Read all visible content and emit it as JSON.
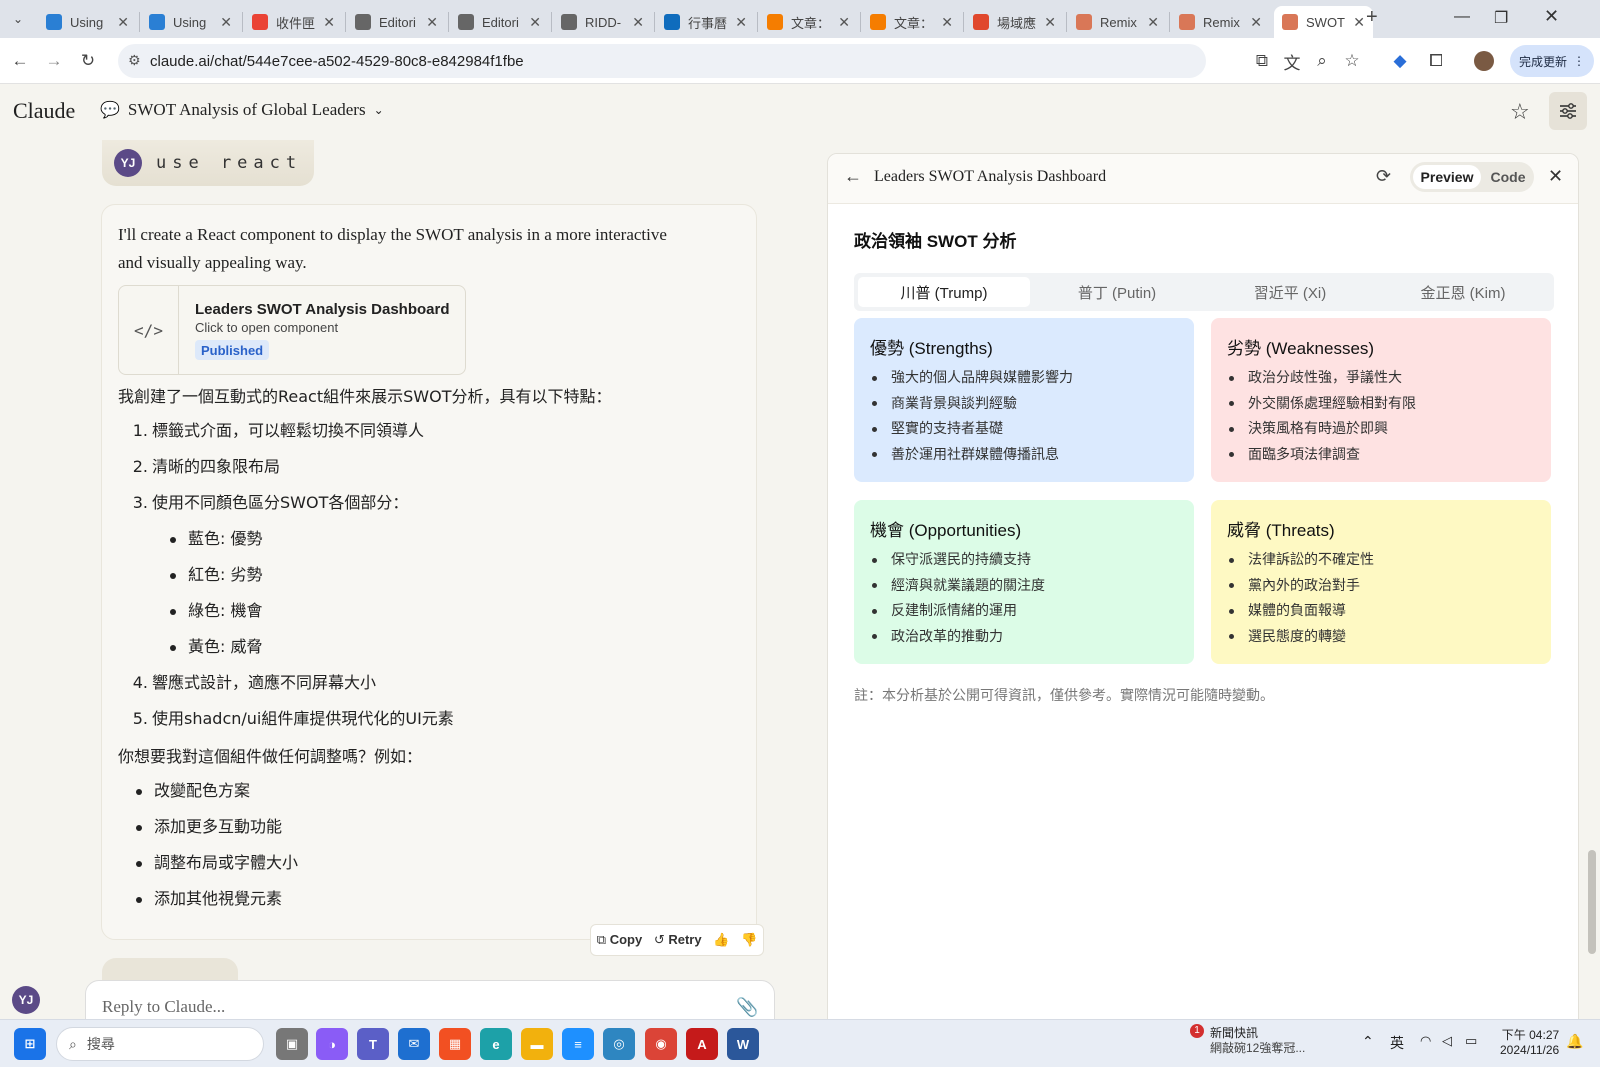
{
  "browser": {
    "tabs": [
      {
        "label": "Using",
        "icon": "copilot-icon",
        "color": "#2a7fd4"
      },
      {
        "label": "Using",
        "icon": "copilot-icon",
        "color": "#2a7fd4"
      },
      {
        "label": "收件匣",
        "icon": "gmail-icon",
        "color": "#ea4335"
      },
      {
        "label": "Editori",
        "icon": "globe-icon",
        "color": "#666666"
      },
      {
        "label": "Editori",
        "icon": "globe-icon",
        "color": "#666666"
      },
      {
        "label": "RIDD-",
        "icon": "globe-icon",
        "color": "#666666"
      },
      {
        "label": "行事曆",
        "icon": "outlook-icon",
        "color": "#0f6cbd"
      },
      {
        "label": "文章：",
        "icon": "blogger-icon",
        "color": "#f57d00"
      },
      {
        "label": "文章：",
        "icon": "blogger-icon",
        "color": "#f57d00"
      },
      {
        "label": "場域應",
        "icon": "blogger-icon",
        "color": "#e0482d"
      },
      {
        "label": "Remix",
        "icon": "claude-icon",
        "color": "#d97757"
      },
      {
        "label": "Remix",
        "icon": "claude-icon",
        "color": "#d97757"
      },
      {
        "label": "SWOT",
        "icon": "claude-icon",
        "color": "#d97757",
        "active": true
      }
    ],
    "url": "claude.ai/chat/544e7cee-a502-4529-80c8-e842984f1fbe",
    "update_label": "完成更新"
  },
  "app": {
    "logo": "Claude",
    "chat_title": "SWOT Analysis of Global Leaders"
  },
  "chat": {
    "user_initials": "YJ",
    "user_message": "use react",
    "intro": "I'll create a React component to display the SWOT analysis in a more interactive and visually appealing way.",
    "artifact": {
      "title": "Leaders SWOT Analysis Dashboard",
      "subtitle": "Click to open component",
      "badge": "Published"
    },
    "lead": "我創建了一個互動式的React組件來展示SWOT分析，具有以下特點：",
    "features": [
      {
        "n": "1.",
        "text": "標籤式介面，可以輕鬆切換不同領導人"
      },
      {
        "n": "2.",
        "text": "清晰的四象限布局"
      },
      {
        "n": "3.",
        "text": "使用不同顏色區分SWOT各個部分："
      }
    ],
    "colors": [
      "藍色: 優勢",
      "紅色: 劣勢",
      "綠色: 機會",
      "黃色: 威脅"
    ],
    "features2": [
      {
        "n": "4.",
        "text": "響應式設計，適應不同屏幕大小"
      },
      {
        "n": "5.",
        "text": "使用shadcn/ui組件庫提供現代化的UI元素"
      }
    ],
    "question": "你想要我對這個組件做任何調整嗎？例如：",
    "suggestions": [
      "改變配色方案",
      "添加更多互動功能",
      "調整布局或字體大小",
      "添加其他視覺元素"
    ],
    "actions": {
      "copy": "Copy",
      "retry": "Retry"
    },
    "reply_placeholder": "Reply to Claude..."
  },
  "panel": {
    "title": "Leaders SWOT Analysis Dashboard",
    "preview": "Preview",
    "code": "Code",
    "dashboard_title": "政治領袖 SWOT 分析",
    "leaders": [
      "川普 (Trump)",
      "普丁 (Putin)",
      "習近平 (Xi)",
      "金正恩 (Kim)"
    ],
    "active_leader": 0,
    "quadrants": {
      "strengths": {
        "title": "優勢 (Strengths)",
        "color": "#dbeafe",
        "items": [
          "強大的個人品牌與媒體影響力",
          "商業背景與談判經驗",
          "堅實的支持者基礎",
          "善於運用社群媒體傳播訊息"
        ]
      },
      "weaknesses": {
        "title": "劣勢 (Weaknesses)",
        "color": "#fee2e2",
        "items": [
          "政治分歧性強，爭議性大",
          "外交關係處理經驗相對有限",
          "決策風格有時過於即興",
          "面臨多項法律調查"
        ]
      },
      "opportunities": {
        "title": "機會 (Opportunities)",
        "color": "#dcfce7",
        "items": [
          "保守派選民的持續支持",
          "經濟與就業議題的關注度",
          "反建制派情緒的運用",
          "政治改革的推動力"
        ]
      },
      "threats": {
        "title": "威脅 (Threats)",
        "color": "#fef9c3",
        "items": [
          "法律訴訟的不確定性",
          "黨內外的政治對手",
          "媒體的負面報導",
          "選民態度的轉變"
        ]
      }
    },
    "note": "註：本分析基於公開可得資訊，僅供參考。實際情況可能隨時變動。"
  },
  "taskbar": {
    "search_placeholder": "搜尋",
    "news_badge": "1",
    "news_title": "新聞快訊",
    "news_sub": "網敲碗12強奪冠...",
    "ime": "英",
    "time": "下午 04:27",
    "date": "2024/11/26"
  }
}
